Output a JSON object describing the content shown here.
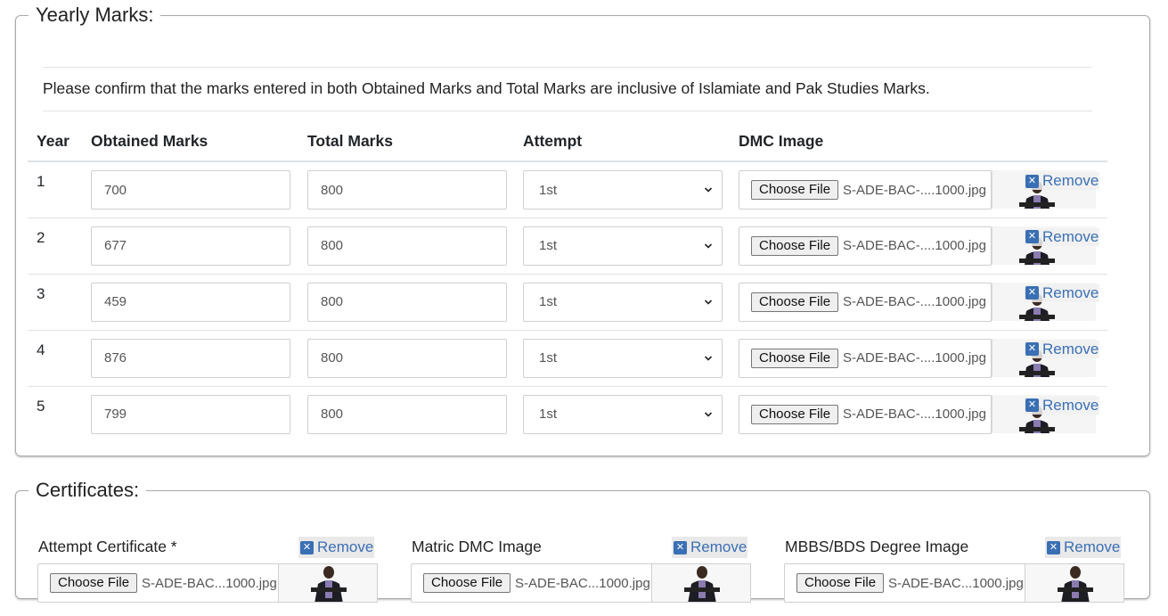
{
  "yearly": {
    "legend": "Yearly Marks:",
    "notice": "Please confirm that the marks entered in both Obtained Marks and Total Marks are inclusive of Islamiate and Pak Studies Marks.",
    "headers": {
      "year": "Year",
      "obtained": "Obtained Marks",
      "total": "Total Marks",
      "attempt": "Attempt",
      "dmc": "DMC Image"
    },
    "rows": [
      {
        "year": "1",
        "obtained": "700",
        "total": "800",
        "attempt": "1st",
        "file_button": "Choose File",
        "file_name": "S-ADE-BAC-....1000.jpg",
        "remove": "Remove"
      },
      {
        "year": "2",
        "obtained": "677",
        "total": "800",
        "attempt": "1st",
        "file_button": "Choose File",
        "file_name": "S-ADE-BAC-....1000.jpg",
        "remove": "Remove"
      },
      {
        "year": "3",
        "obtained": "459",
        "total": "800",
        "attempt": "1st",
        "file_button": "Choose File",
        "file_name": "S-ADE-BAC-....1000.jpg",
        "remove": "Remove"
      },
      {
        "year": "4",
        "obtained": "876",
        "total": "800",
        "attempt": "1st",
        "file_button": "Choose File",
        "file_name": "S-ADE-BAC-....1000.jpg",
        "remove": "Remove"
      },
      {
        "year": "5",
        "obtained": "799",
        "total": "800",
        "attempt": "1st",
        "file_button": "Choose File",
        "file_name": "S-ADE-BAC-....1000.jpg",
        "remove": "Remove"
      }
    ]
  },
  "certificates": {
    "legend": "Certificates:",
    "items": [
      {
        "label": "Attempt Certificate *",
        "remove": "Remove",
        "file_button": "Choose File",
        "file_name": "S-ADE-BAC...1000.jpg"
      },
      {
        "label": "Matric DMC Image",
        "remove": "Remove",
        "file_button": "Choose File",
        "file_name": "S-ADE-BAC...1000.jpg"
      },
      {
        "label": "MBBS/BDS Degree Image",
        "remove": "Remove",
        "file_button": "Choose File",
        "file_name": "S-ADE-BAC...1000.jpg"
      }
    ]
  },
  "icons": {
    "remove": "close-square-icon",
    "select": "chevron-down-icon",
    "thumbnail": "person-thumbnail"
  },
  "colors": {
    "link": "#3a6fb4",
    "border": "#cfcfcf"
  }
}
